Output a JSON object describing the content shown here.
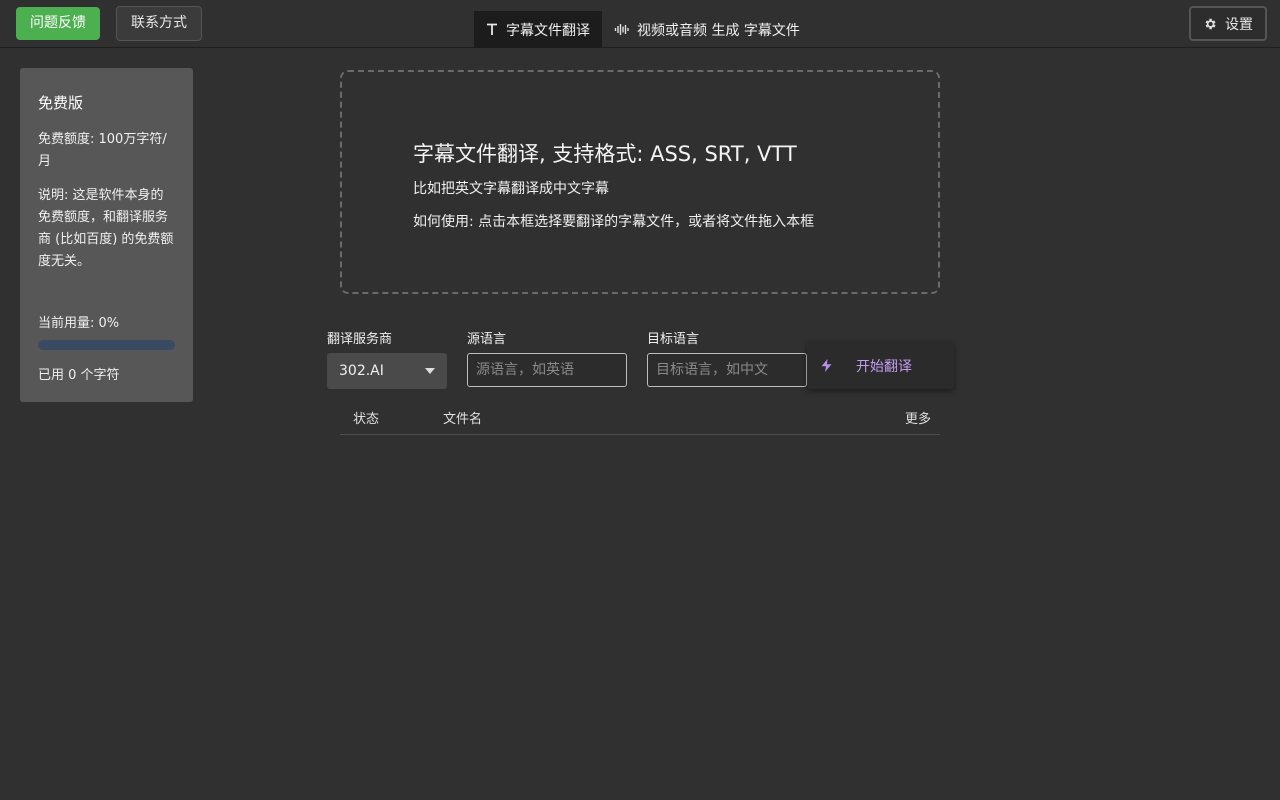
{
  "header": {
    "feedback_label": "问题反馈",
    "contact_label": "联系方式",
    "settings_label": "设置",
    "tabs": [
      {
        "label": "字幕文件翻译",
        "icon": "text-icon",
        "active": true
      },
      {
        "label": "视频或音频 生成 字幕文件",
        "icon": "audio-wave-icon",
        "active": false
      }
    ]
  },
  "plan": {
    "title": "免费版",
    "quota": "免费额度: 100万字符/月",
    "note": "说明: 这是软件本身的免费额度，和翻译服务商 (比如百度) 的免费额度无关。",
    "usage_label": "当前用量: 0%",
    "usage_fraction": 0,
    "used_text": "已用 0 个字符"
  },
  "dropzone": {
    "title": "字幕文件翻译, 支持格式: ASS, SRT, VTT",
    "line1": "比如把英文字幕翻译成中文字幕",
    "line2": "如何使用: 点击本框选择要翻译的字幕文件，或者将文件拖入本框"
  },
  "form": {
    "provider_label": "翻译服务商",
    "provider_value": "302.AI",
    "source_label": "源语言",
    "source_placeholder": "源语言，如英语",
    "target_label": "目标语言",
    "target_placeholder": "目标语言，如中文",
    "start_label": "开始翻译"
  },
  "table": {
    "columns": [
      "状态",
      "文件名",
      "更多"
    ]
  },
  "colors": {
    "background": "#303030",
    "feedback_button": "#4caf50",
    "accent_purple": "#c39cf0",
    "card": "#575757"
  }
}
